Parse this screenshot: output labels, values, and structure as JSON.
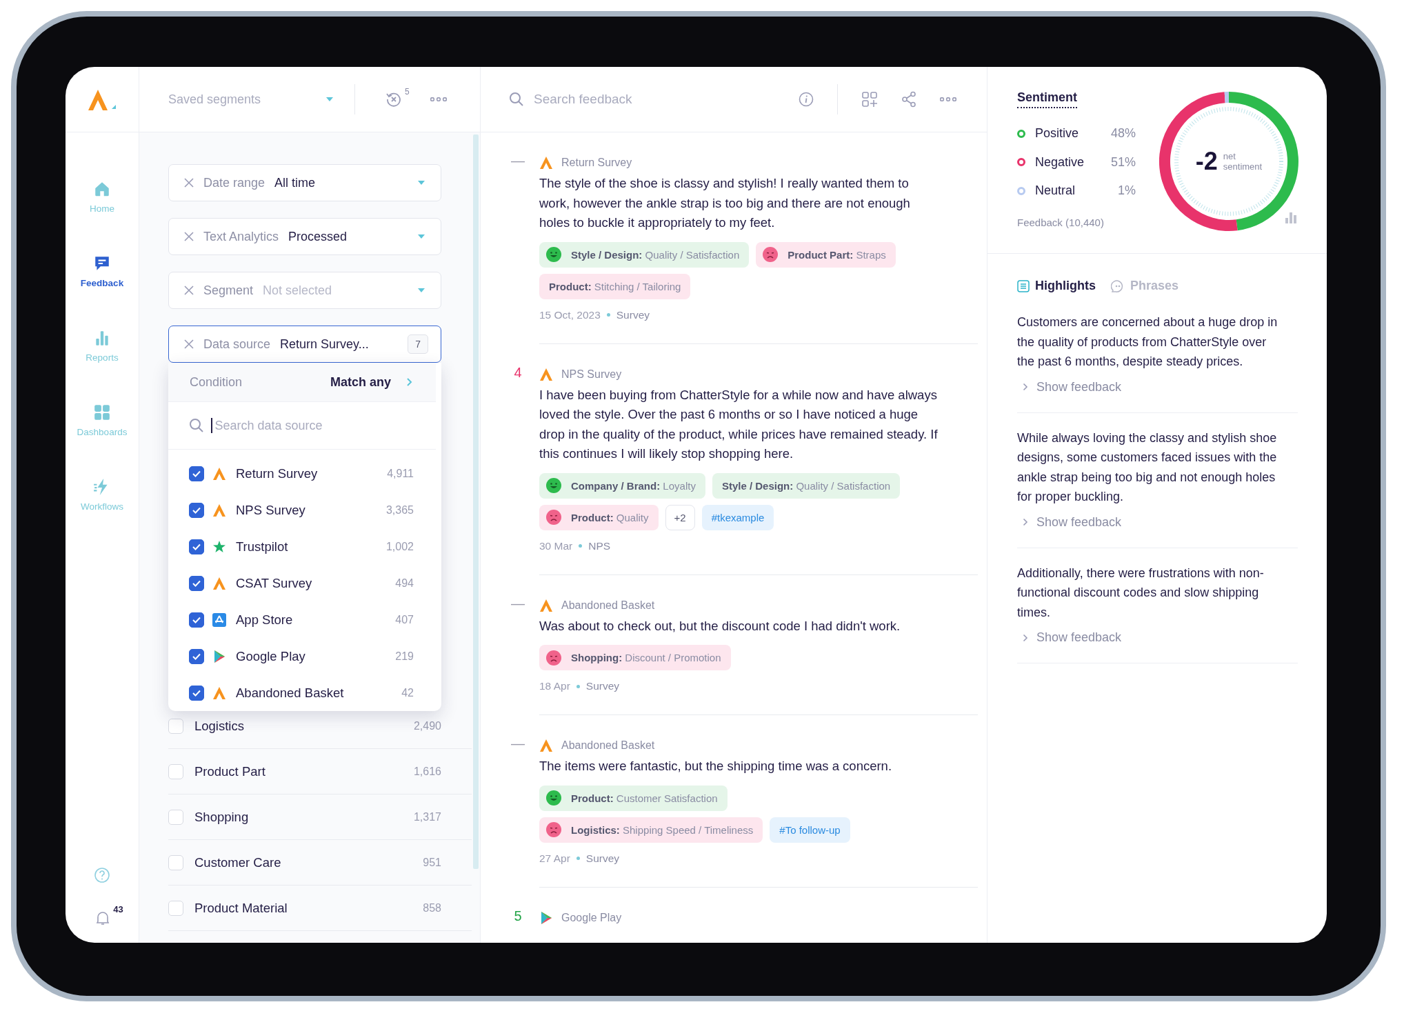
{
  "sidebar": {
    "nav": [
      {
        "label": "Home",
        "kind": "home",
        "selected": false
      },
      {
        "label": "Feedback",
        "kind": "feedback",
        "selected": true
      },
      {
        "label": "Reports",
        "kind": "reports",
        "selected": false
      },
      {
        "label": "Dashboards",
        "kind": "dashboards",
        "selected": false
      },
      {
        "label": "Workflows",
        "kind": "workflows",
        "selected": false
      }
    ],
    "notifications": {
      "count": "43"
    }
  },
  "filter_panel": {
    "saved_segments": {
      "placeholder": "Saved segments"
    },
    "history_count": "5",
    "filters": [
      {
        "label": "Date range",
        "value": "All time",
        "open": false
      },
      {
        "label": "Text Analytics",
        "value": "Processed",
        "open": false
      },
      {
        "label": "Segment",
        "placeholder": "Not selected",
        "open": false
      },
      {
        "label": "Data source",
        "value": "Return Survey...",
        "count": "7",
        "open": true
      }
    ],
    "data_source_menu": {
      "condition_label": "Condition",
      "condition_value": "Match any",
      "search": {
        "placeholder": "Search data source"
      },
      "items": [
        {
          "label": "Return Survey",
          "count": "4,911",
          "checked": true,
          "kind": "survey"
        },
        {
          "label": "NPS Survey",
          "count": "3,365",
          "checked": true,
          "kind": "survey"
        },
        {
          "label": "Trustpilot",
          "count": "1,002",
          "checked": true,
          "kind": "trustpilot"
        },
        {
          "label": "CSAT Survey",
          "count": "494",
          "checked": true,
          "kind": "survey"
        },
        {
          "label": "App Store",
          "count": "407",
          "checked": true,
          "kind": "appstore"
        },
        {
          "label": "Google Play",
          "count": "219",
          "checked": true,
          "kind": "googleplay"
        },
        {
          "label": "Abandoned Basket",
          "count": "42",
          "checked": true,
          "kind": "survey"
        }
      ]
    },
    "categories": [
      {
        "label": "Logistics",
        "count": "2,490",
        "checked": false
      },
      {
        "label": "Product Part",
        "count": "1,616",
        "checked": false
      },
      {
        "label": "Shopping",
        "count": "1,317",
        "checked": false
      },
      {
        "label": "Customer Care",
        "count": "951",
        "checked": false
      },
      {
        "label": "Product Material",
        "count": "858",
        "checked": false
      }
    ]
  },
  "feed": {
    "search": {
      "placeholder": "Search feedback"
    },
    "items": [
      {
        "score": {
          "text": "—",
          "color": "#9b9bab"
        },
        "source": {
          "kind": "survey",
          "label": "Return Survey"
        },
        "text": "The style of the shoe is classy and stylish! I really wanted them to work, however the ankle strap is too big and there are not enough holes to buckle it appropriately to my feet.",
        "tags": [
          {
            "kind": "positive",
            "face": true,
            "text": "**Style / Design:** Quality / Satisfaction"
          },
          {
            "kind": "negative",
            "face": true,
            "text": "**Product Part:** Straps"
          },
          {
            "kind": "negative",
            "face": false,
            "text": "**Product:** Stitching / Tailoring"
          }
        ],
        "date": "15 Oct, 2023",
        "channel": "Survey"
      },
      {
        "score": {
          "text": "4",
          "color": "#e8336b"
        },
        "source": {
          "kind": "survey",
          "label": "NPS Survey"
        },
        "text": "I have been buying from ChatterStyle for a while now and have always loved the style. Over the past 6 months or so I have noticed a huge drop in the quality of the product, while prices have remained steady. If this continues I will likely stop shopping here.",
        "tags": [
          {
            "kind": "positive",
            "face": true,
            "text": "**Company / Brand:** Loyalty"
          },
          {
            "kind": "positive",
            "face": false,
            "text": "**Style / Design:** Quality / Satisfaction"
          },
          {
            "kind": "negative",
            "face": true,
            "text": "**Product:** Quality"
          },
          {
            "kind": "more",
            "text": "+2"
          },
          {
            "kind": "hashtag",
            "text": "#tkexample"
          }
        ],
        "date": "30 Mar",
        "channel": "NPS"
      },
      {
        "score": {
          "text": "—",
          "color": "#9b9bab"
        },
        "source": {
          "kind": "survey",
          "label": "Abandoned Basket"
        },
        "text": "Was about to check out, but the discount code I had didn't work.",
        "tags": [
          {
            "kind": "negative",
            "face": true,
            "text": "**Shopping:** Discount / Promotion"
          }
        ],
        "date": "18 Apr",
        "channel": "Survey"
      },
      {
        "score": {
          "text": "—",
          "color": "#9b9bab"
        },
        "source": {
          "kind": "survey",
          "label": "Abandoned Basket"
        },
        "text": "The items were fantastic, but the shipping time was a concern.",
        "tags": [
          {
            "kind": "positive",
            "face": true,
            "text": "**Product:** Customer Satisfaction"
          },
          {
            "kind": "negative",
            "face": true,
            "text": "**Logistics:** Shipping Speed / Timeliness"
          },
          {
            "kind": "hashtag",
            "text": "#To follow-up"
          }
        ],
        "date": "27 Apr",
        "channel": "Survey"
      },
      {
        "score": {
          "text": "5",
          "color": "#22a447"
        },
        "source": {
          "kind": "googleplay",
          "label": "Google Play"
        }
      }
    ]
  },
  "insights": {
    "sentiment": {
      "title": "Sentiment",
      "legend": [
        {
          "label": "Positive",
          "percent": "48%",
          "color": "#2dbb4d"
        },
        {
          "label": "Negative",
          "percent": "51%",
          "color": "#e8336b"
        },
        {
          "label": "Neutral",
          "percent": "1%",
          "color": "#b7caf0"
        }
      ],
      "feedback_count": "Feedback (10,440)",
      "net_value": "-2",
      "net_label": "net sentiment",
      "chart_data": {
        "type": "donut",
        "values": [
          48,
          51,
          1
        ]
      }
    },
    "tabs": [
      {
        "label": "Highlights",
        "kind": "list",
        "selected": true
      },
      {
        "label": "Phrases",
        "kind": "quote",
        "selected": false
      }
    ],
    "highlights": [
      {
        "text": "Customers are concerned about a huge drop in the quality of products from ChatterStyle over the past 6 months, despite steady prices.",
        "link": "Show feedback"
      },
      {
        "text": "While always loving the classy and stylish shoe designs, some customers faced issues with the ankle strap being too big and not enough holes for proper buckling.",
        "link": "Show feedback"
      },
      {
        "text": "Additionally, there were frustrations with non-functional discount codes and slow shipping times.",
        "link": "Show feedback"
      }
    ]
  }
}
